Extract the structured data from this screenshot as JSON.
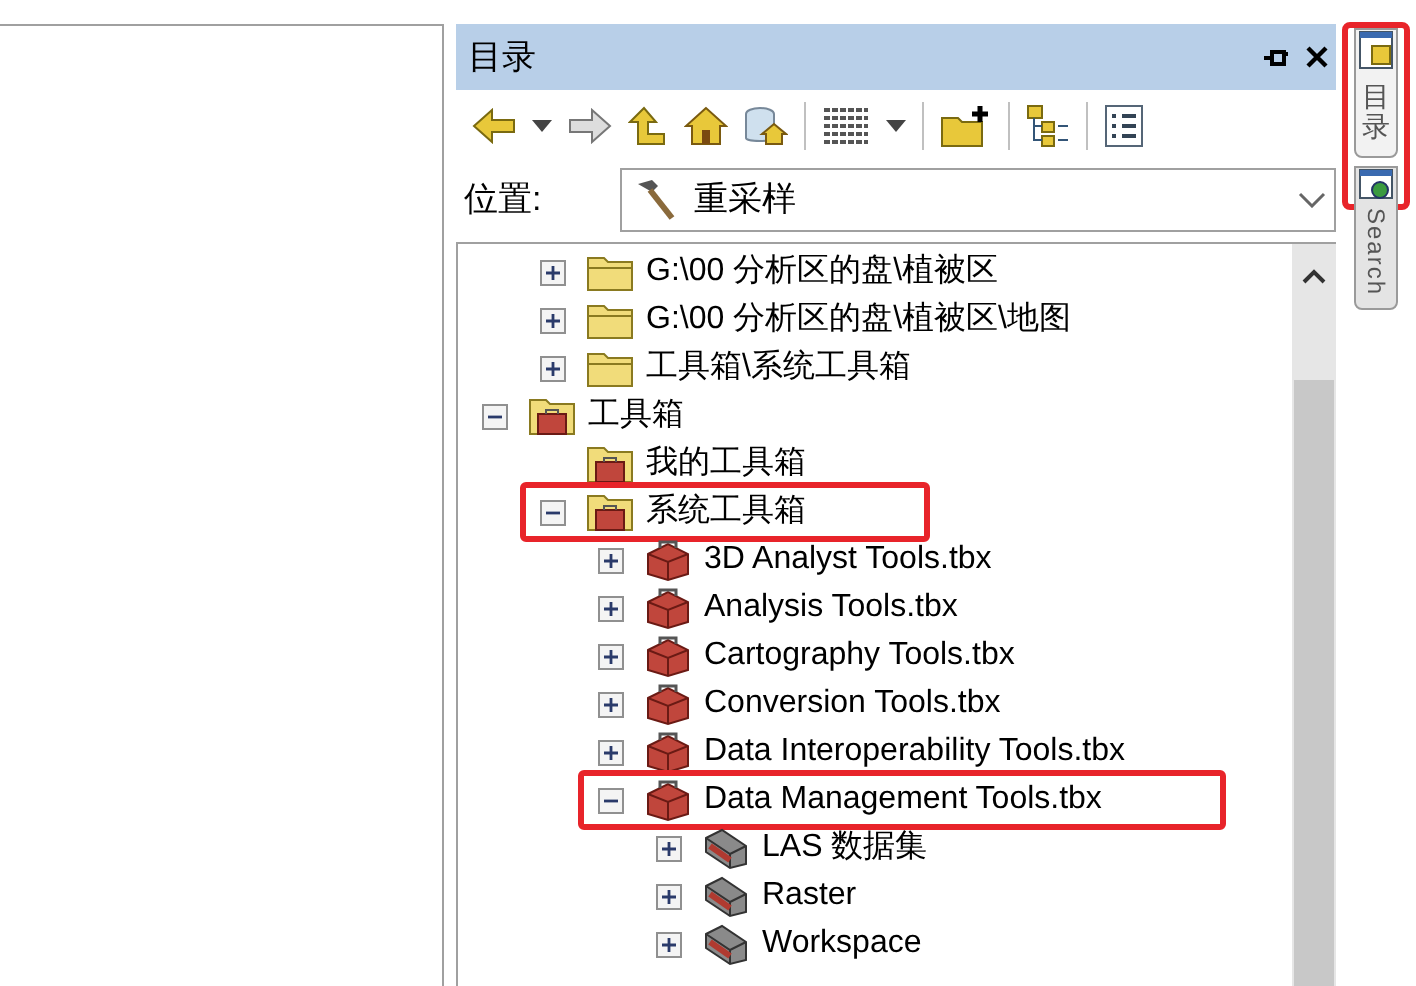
{
  "panel": {
    "title": "目录"
  },
  "toolbar": {
    "buttons": [
      {
        "kind": "back"
      },
      {
        "kind": "caret"
      },
      {
        "kind": "forward"
      },
      {
        "kind": "up"
      },
      {
        "kind": "home"
      },
      {
        "kind": "dbhome"
      },
      {
        "kind": "sep"
      },
      {
        "kind": "grid"
      },
      {
        "kind": "caret"
      },
      {
        "kind": "sep"
      },
      {
        "kind": "connect"
      },
      {
        "kind": "sep"
      },
      {
        "kind": "tree"
      },
      {
        "kind": "sep"
      },
      {
        "kind": "list"
      }
    ]
  },
  "location": {
    "label": "位置:",
    "value": "重采样"
  },
  "tree": {
    "items": [
      {
        "children": [
          {
            "label": "G:\\00 分析区的盘\\植被区",
            "kind": "folder",
            "expanded": false,
            "highlighted": false
          },
          {
            "label": "G:\\00 分析区的盘\\植被区\\地图",
            "kind": "folder",
            "expanded": false,
            "highlighted": false
          },
          {
            "label": "工具箱\\系统工具箱",
            "kind": "folder",
            "expanded": false,
            "highlighted": false
          }
        ]
      },
      {
        "label": "工具箱",
        "kind": "toolbox-folder",
        "expanded": true,
        "highlighted": false,
        "children": [
          {
            "label": "我的工具箱",
            "kind": "toolbox-folder",
            "highlighted": false
          },
          {
            "label": "系统工具箱",
            "kind": "toolbox-folder",
            "expanded": true,
            "highlighted": true,
            "children": [
              {
                "label": "3D Analyst Tools.tbx",
                "kind": "toolbox",
                "expanded": false,
                "highlighted": false
              },
              {
                "label": "Analysis Tools.tbx",
                "kind": "toolbox",
                "expanded": false,
                "highlighted": false
              },
              {
                "label": "Cartography Tools.tbx",
                "kind": "toolbox",
                "expanded": false,
                "highlighted": false
              },
              {
                "label": "Conversion Tools.tbx",
                "kind": "toolbox",
                "expanded": false,
                "highlighted": false
              },
              {
                "label": "Data Interoperability Tools.tbx",
                "kind": "toolbox",
                "expanded": false,
                "highlighted": false
              },
              {
                "label": "Data Management Tools.tbx",
                "kind": "toolbox",
                "expanded": true,
                "highlighted": true,
                "children": [
                  {
                    "label": "LAS 数据集",
                    "kind": "toolset",
                    "expanded": false,
                    "highlighted": false
                  },
                  {
                    "label": "Raster",
                    "kind": "toolset",
                    "expanded": false,
                    "highlighted": false
                  },
                  {
                    "label": "Workspace",
                    "kind": "toolset",
                    "expanded": false,
                    "highlighted": false
                  }
                ]
              }
            ]
          }
        ]
      }
    ]
  },
  "side_tabs": [
    {
      "label": "目录",
      "kind": "catalog",
      "selected": true,
      "highlighted": true
    },
    {
      "label": "Search",
      "kind": "search",
      "selected": false,
      "highlighted": false
    }
  ]
}
